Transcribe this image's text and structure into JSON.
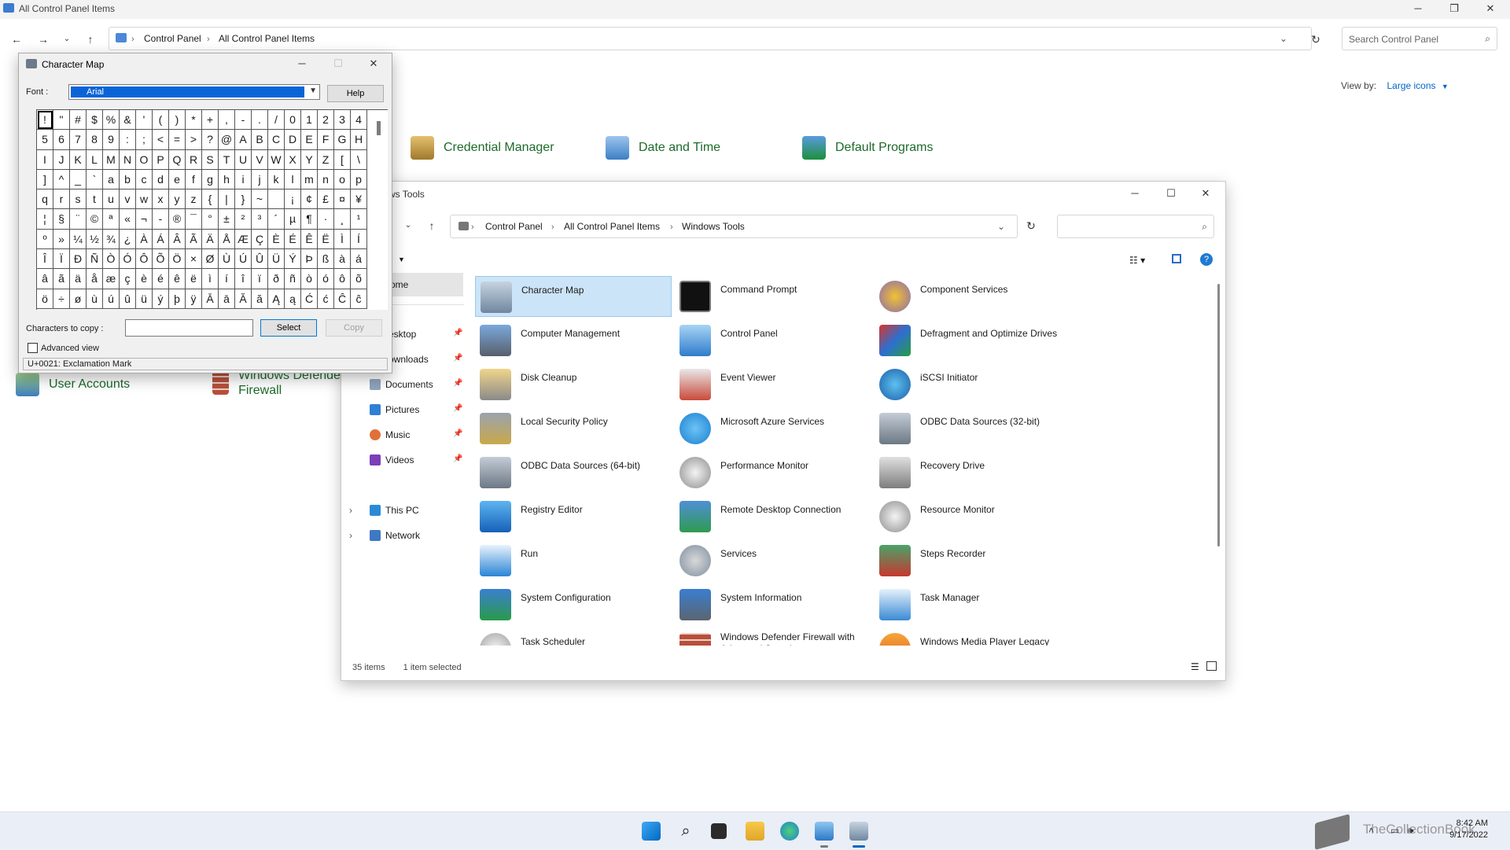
{
  "control_panel": {
    "window_title": "All Control Panel Items",
    "breadcrumbs": [
      "Control Panel",
      "All Control Panel Items"
    ],
    "search_placeholder": "Search Control Panel",
    "view_by_label": "View by:",
    "view_by_value": "Large icons",
    "items": [
      {
        "label": "Credential Manager"
      },
      {
        "label": "Date and Time"
      },
      {
        "label": "Default Programs"
      },
      {
        "label": "User Accounts"
      },
      {
        "label": "Windows Defender Firewall"
      }
    ]
  },
  "windows_tools": {
    "window_title": "Windows Tools",
    "window_title_visible": "ws Tools",
    "breadcrumbs": [
      "Control Panel",
      "All Control Panel Items",
      "Windows Tools"
    ],
    "sidebar": [
      {
        "label": "ome",
        "icon": "home-icon"
      },
      {
        "label": "esktop",
        "icon": "desktop-icon",
        "pinned": true
      },
      {
        "label": "ownloads",
        "icon": "downloads-icon",
        "pinned": true
      },
      {
        "label": "Documents",
        "icon": "documents-icon",
        "pinned": true
      },
      {
        "label": "Pictures",
        "icon": "pictures-icon",
        "pinned": true
      },
      {
        "label": "Music",
        "icon": "music-icon",
        "pinned": true
      },
      {
        "label": "Videos",
        "icon": "videos-icon",
        "pinned": true
      },
      {
        "label": "This PC",
        "icon": "this-pc-icon"
      },
      {
        "label": "Network",
        "icon": "network-icon"
      }
    ],
    "items": [
      {
        "label": "Character Map",
        "selected": true
      },
      {
        "label": "Command Prompt"
      },
      {
        "label": "Component Services"
      },
      {
        "label": "Computer Management"
      },
      {
        "label": "Control Panel"
      },
      {
        "label": "Defragment and Optimize Drives"
      },
      {
        "label": "Disk Cleanup"
      },
      {
        "label": "Event Viewer"
      },
      {
        "label": "iSCSI Initiator"
      },
      {
        "label": "Local Security Policy"
      },
      {
        "label": "Microsoft Azure Services"
      },
      {
        "label": "ODBC Data Sources (32-bit)"
      },
      {
        "label": "ODBC Data Sources (64-bit)"
      },
      {
        "label": "Performance Monitor"
      },
      {
        "label": "Recovery Drive"
      },
      {
        "label": "Registry Editor"
      },
      {
        "label": "Remote Desktop Connection"
      },
      {
        "label": "Resource Monitor"
      },
      {
        "label": "Run"
      },
      {
        "label": "Services"
      },
      {
        "label": "Steps Recorder"
      },
      {
        "label": "System Configuration"
      },
      {
        "label": "System Information"
      },
      {
        "label": "Task Manager"
      },
      {
        "label": "Task Scheduler"
      },
      {
        "label": "Windows Defender Firewall with Advanced Security"
      },
      {
        "label": "Windows Media Player Legacy"
      }
    ],
    "status_count": "35 items",
    "status_selected": "1 item selected"
  },
  "character_map": {
    "title": "Character Map",
    "font_label": "Font :",
    "font_value": "Arial",
    "help_label": "Help",
    "chars": [
      "!",
      "\"",
      "#",
      "$",
      "%",
      "&",
      "'",
      "(",
      ")",
      "*",
      "+",
      ",",
      "-",
      ".",
      "/",
      "0",
      "1",
      "2",
      "3",
      "4",
      "5",
      "6",
      "7",
      "8",
      "9",
      ":",
      ";",
      "<",
      "=",
      ">",
      "?",
      "@",
      "A",
      "B",
      "C",
      "D",
      "E",
      "F",
      "G",
      "H",
      "I",
      "J",
      "K",
      "L",
      "M",
      "N",
      "O",
      "P",
      "Q",
      "R",
      "S",
      "T",
      "U",
      "V",
      "W",
      "X",
      "Y",
      "Z",
      "[",
      "\\",
      "]",
      "^",
      "_",
      "`",
      "a",
      "b",
      "c",
      "d",
      "e",
      "f",
      "g",
      "h",
      "i",
      "j",
      "k",
      "l",
      "m",
      "n",
      "o",
      "p",
      "q",
      "r",
      "s",
      "t",
      "u",
      "v",
      "w",
      "x",
      "y",
      "z",
      "{",
      "|",
      "}",
      "~",
      " ",
      "¡",
      "¢",
      "£",
      "¤",
      "¥",
      "¦",
      "§",
      "¨",
      "©",
      "ª",
      "«",
      "¬",
      "-",
      "®",
      "¯",
      "°",
      "±",
      "²",
      "³",
      "´",
      "µ",
      "¶",
      "·",
      "¸",
      "¹",
      "º",
      "»",
      "¼",
      "½",
      "¾",
      "¿",
      "À",
      "Á",
      "Â",
      "Ã",
      "Ä",
      "Å",
      "Æ",
      "Ç",
      "È",
      "É",
      "Ê",
      "Ë",
      "Ì",
      "Í",
      "Î",
      "Ï",
      "Ð",
      "Ñ",
      "Ò",
      "Ó",
      "Ô",
      "Õ",
      "Ö",
      "×",
      "Ø",
      "Ù",
      "Ú",
      "Û",
      "Ü",
      "Ý",
      "Þ",
      "ß",
      "à",
      "á",
      "â",
      "ã",
      "ä",
      "å",
      "æ",
      "ç",
      "è",
      "é",
      "ê",
      "ë",
      "ì",
      "í",
      "î",
      "ï",
      "ð",
      "ñ",
      "ò",
      "ó",
      "ô",
      "õ",
      "ö",
      "÷",
      "ø",
      "ù",
      "ú",
      "û",
      "ü",
      "ý",
      "þ",
      "ÿ",
      "Ā",
      "ā",
      "Ă",
      "ă",
      "Ą",
      "ą",
      "Ć",
      "ć",
      "Ĉ",
      "ĉ"
    ],
    "copy_label": "Characters to copy :",
    "copy_value": "",
    "select_label": "Select",
    "copy_button_label": "Copy",
    "advanced_label": "Advanced view",
    "status": "U+0021: Exclamation Mark"
  },
  "taskbar": {
    "time": "8:42 AM",
    "date": "9/17/2022",
    "watermark": "TheCollectionBook"
  },
  "colors": {
    "accent": "#0078d7",
    "selection": "#cce4f7",
    "cp_link": "#1c6b2a"
  }
}
